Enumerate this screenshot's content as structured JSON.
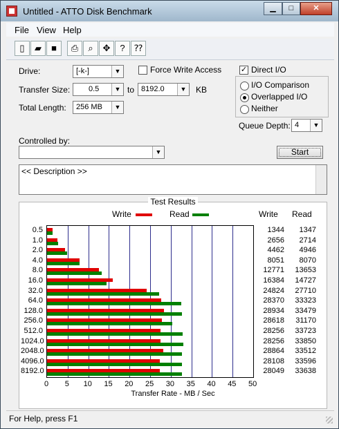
{
  "window": {
    "title": "Untitled - ATTO Disk Benchmark",
    "controls": {
      "minimize": "▁",
      "maximize": "□",
      "close": "✕"
    }
  },
  "menu": [
    "File",
    "View",
    "Help"
  ],
  "toolbar_icons": [
    "new-icon",
    "open-icon",
    "save-icon",
    "print-icon",
    "print-preview-icon",
    "move-icon",
    "help-icon",
    "context-help-icon"
  ],
  "settings": {
    "drive_label": "Drive:",
    "drive_value": "[-k-]",
    "force_write_label": "Force Write Access",
    "force_write_checked": false,
    "direct_io_label": "Direct I/O",
    "direct_io_checked": true,
    "transfer_size_label": "Transfer Size:",
    "transfer_from": "0.5",
    "to_label": "to",
    "transfer_to": "8192.0",
    "kb_label": "KB",
    "total_length_label": "Total Length:",
    "total_length_value": "256 MB",
    "io_modes": [
      {
        "label": "I/O Comparison",
        "selected": false
      },
      {
        "label": "Overlapped I/O",
        "selected": true
      },
      {
        "label": "Neither",
        "selected": false
      }
    ],
    "queue_depth_label": "Queue Depth:",
    "queue_depth_value": "4",
    "controlled_by_label": "Controlled by:",
    "controlled_by_value": "",
    "start_label": "Start",
    "description": "<< Description >>"
  },
  "status": "For Help, press F1",
  "chart_data": {
    "type": "bar",
    "title": "Test Results",
    "xlabel": "Transfer Rate - MB / Sec",
    "xlim": [
      0,
      50
    ],
    "xticks": [
      "0",
      "5",
      "10",
      "15",
      "20",
      "25",
      "30",
      "35",
      "40",
      "45",
      "50"
    ],
    "legend": [
      {
        "name": "Write",
        "color": "#e00000"
      },
      {
        "name": "Read",
        "color": "#008000"
      }
    ],
    "column_headers": [
      "Write",
      "Read"
    ],
    "categories": [
      "0.5",
      "1.0",
      "2.0",
      "4.0",
      "8.0",
      "16.0",
      "32.0",
      "64.0",
      "128.0",
      "256.0",
      "512.0",
      "1024.0",
      "2048.0",
      "4096.0",
      "8192.0"
    ],
    "write_values": [
      1344,
      2656,
      4462,
      8051,
      12771,
      16384,
      24824,
      28370,
      28934,
      28618,
      28256,
      28256,
      28864,
      28108,
      28049
    ],
    "read_values": [
      1347,
      2714,
      4946,
      8070,
      13653,
      14727,
      27710,
      33323,
      33479,
      31170,
      33723,
      33850,
      33512,
      33596,
      33638
    ],
    "series": [
      {
        "name": "Write",
        "values": [
          1.3,
          2.6,
          4.4,
          7.9,
          12.5,
          16.0,
          24.2,
          27.7,
          28.3,
          27.9,
          27.6,
          27.6,
          28.2,
          27.4,
          27.4
        ]
      },
      {
        "name": "Read",
        "values": [
          1.3,
          2.7,
          4.8,
          7.9,
          13.3,
          14.4,
          27.1,
          32.5,
          32.7,
          30.4,
          32.9,
          33.1,
          32.7,
          32.8,
          32.8
        ]
      }
    ]
  }
}
